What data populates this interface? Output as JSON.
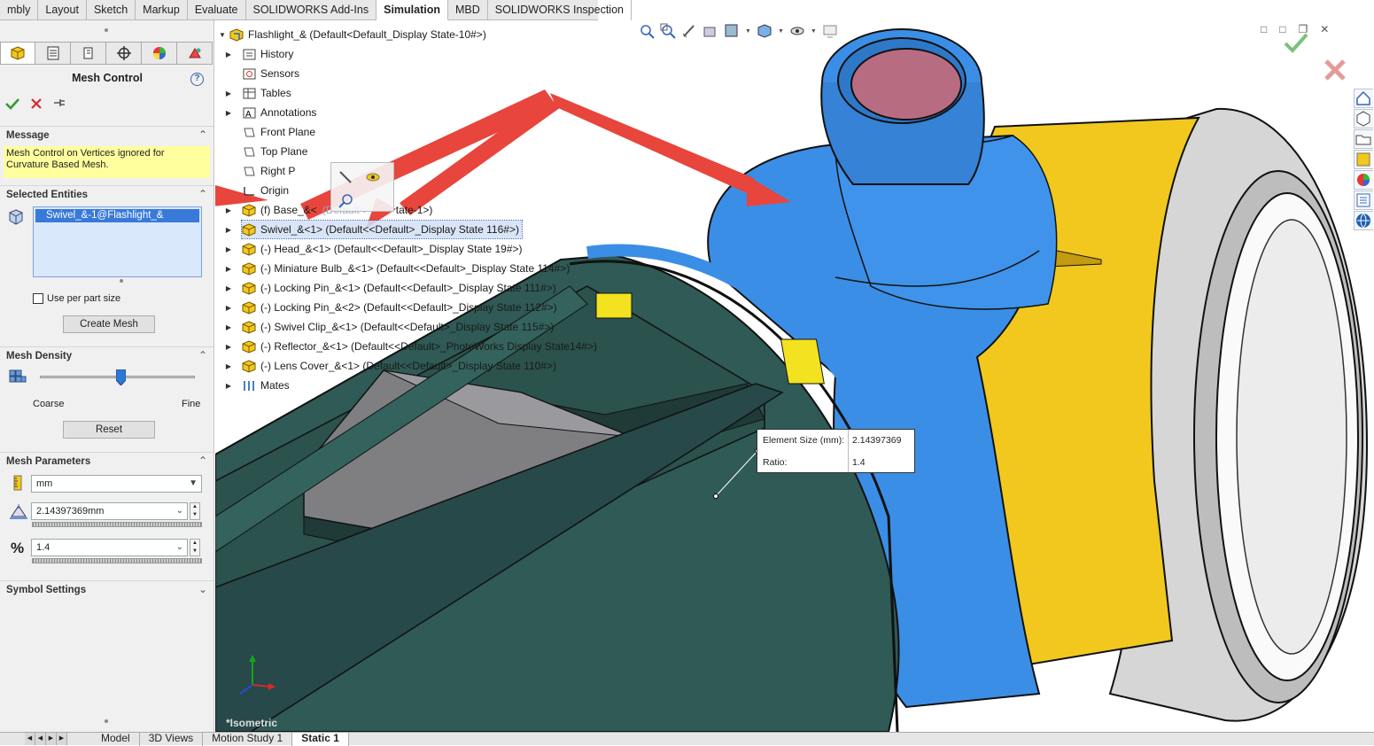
{
  "command_tabs": [
    "mbly",
    "Layout",
    "Sketch",
    "Markup",
    "Evaluate",
    "SOLIDWORKS Add-Ins",
    "Simulation",
    "MBD",
    "SOLIDWORKS Inspection"
  ],
  "active_command_tab": "Simulation",
  "property_manager": {
    "title": "Mesh Control",
    "help_glyph": "?",
    "message_section": "Message",
    "message_text": "Mesh Control on Vertices ignored for Curvature Based Mesh.",
    "selected_section": "Selected Entities",
    "selected_items": [
      "Swivel_&-1@Flashlight_&"
    ],
    "use_per_part_size": "Use per part size",
    "create_mesh": "Create Mesh",
    "density_section": "Mesh Density",
    "coarse": "Coarse",
    "fine": "Fine",
    "density_level": 0.52,
    "reset": "Reset",
    "params_section": "Mesh Parameters",
    "unit": "mm",
    "element_size": "2.14397369mm",
    "ratio": "1.4",
    "symbol_section": "Symbol Settings"
  },
  "tree": {
    "root": "Flashlight_&  (Default<Default_Display State-10#>)",
    "items": [
      {
        "label": "History"
      },
      {
        "label": "Sensors"
      },
      {
        "label": "Tables"
      },
      {
        "label": "Annotations"
      },
      {
        "label": "Front Plane"
      },
      {
        "label": "Top Plane"
      },
      {
        "label": "Right P"
      },
      {
        "label": "Origin"
      },
      {
        "label": "(f) Base_&<",
        "hidden_tail": "(Default<",
        "tail2": "tate-1>)"
      },
      {
        "label": "Swivel_&<1> (Default<<Default>_Display State 116#>)"
      },
      {
        "label": "(-) Head_&<1> (Default<<Default>_Display State 19#>)"
      },
      {
        "label": "(-) Miniature Bulb_&<1> (Default<<Default>_Display State 114#>)"
      },
      {
        "label": "(-) Locking Pin_&<1> (Default<<Default>_Display State 111#>)"
      },
      {
        "label": "(-) Locking Pin_&<2> (Default<<Default>_Display State 112#>)"
      },
      {
        "label": "(-) Swivel Clip_&<1> (Default<<Default>_Display State 115#>)"
      },
      {
        "label": "(-) Reflector_&<1> (Default<<Default>_PhotoWorks Display State14#>)"
      },
      {
        "label": "(-) Lens Cover_&<1> (Default<<Default>_Display State 110#>)"
      },
      {
        "label": "Mates"
      }
    ]
  },
  "tooltip": {
    "element_size_label": "Element Size (mm):",
    "element_size_value": "2.14397369",
    "ratio_label": "Ratio:",
    "ratio_value": "1.4"
  },
  "view_label": "*Isometric",
  "bottom_tabs": [
    "Model",
    "3D Views",
    "Motion Study 1",
    "Static 1"
  ],
  "active_bottom_tab": "Static 1",
  "colors": {
    "swivel_blue": "#3b8ee6",
    "gold": "#f2c81f",
    "body_green": "#2f5a55",
    "arrow_red": "#e8453c",
    "selection_blue": "#3879d9"
  }
}
